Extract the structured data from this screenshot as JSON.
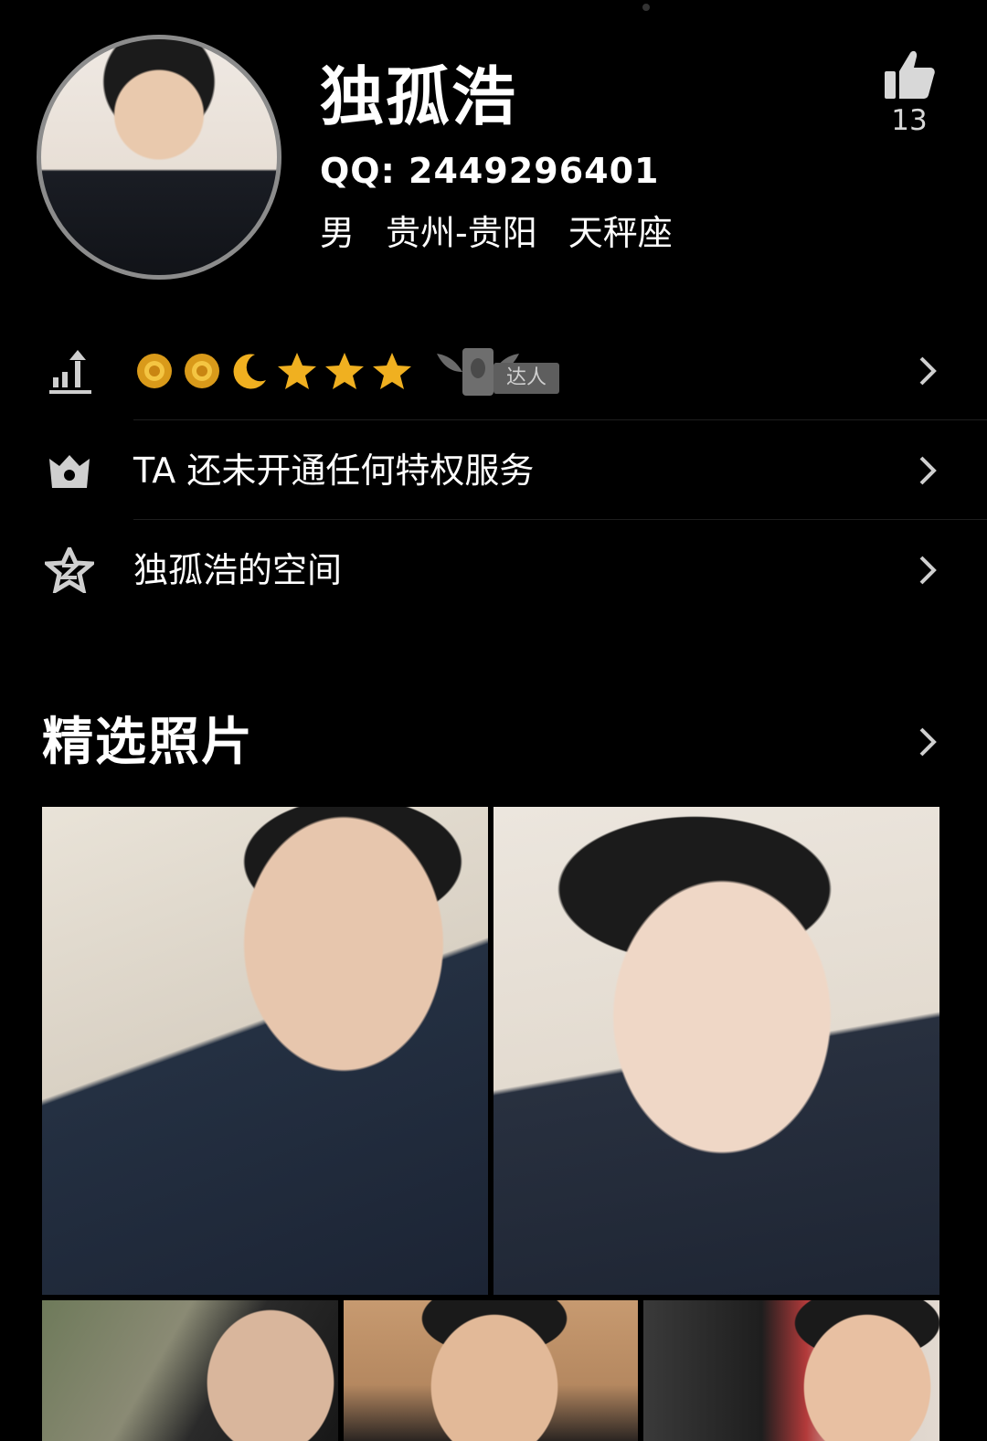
{
  "profile": {
    "name": "独孤浩",
    "qq_label": "QQ:",
    "qq_number": "2449296401",
    "gender": "男",
    "location": "贵州-贵阳",
    "zodiac": "天秤座",
    "like_count": "13"
  },
  "level_row": {
    "badges": [
      "sun-badge-icon",
      "sun-badge-icon",
      "moon-badge-icon",
      "star-badge-icon",
      "star-badge-icon",
      "star-badge-icon"
    ],
    "daren_label": "达人"
  },
  "privilege_row": {
    "label": "TA 还未开通任何特权服务"
  },
  "space_row": {
    "label": "独孤浩的空间"
  },
  "photos_section": {
    "title": "精选照片"
  },
  "colors": {
    "background": "#000000",
    "text": "#ffffff",
    "badge_gold": "#f0b020",
    "muted": "#8c8c8c"
  }
}
